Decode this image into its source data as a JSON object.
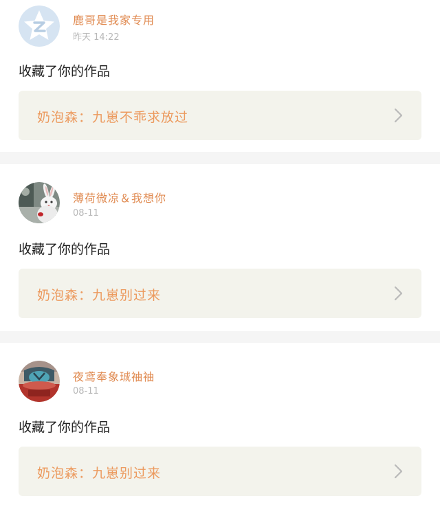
{
  "notifications": [
    {
      "username": "鹿哥是我家专用",
      "time": "昨天 14:22",
      "action": "收藏了你的作品",
      "work_text": "奶泡森：九崽不乖求放过",
      "avatar_icon": "qzone-default-avatar-icon"
    },
    {
      "username": "薄荷微凉＆我想你",
      "time": "08-11",
      "action": "收藏了你的作品",
      "work_text": "奶泡森：九崽别过来",
      "avatar_icon": "rabbit-avatar-photo"
    },
    {
      "username": "夜鸢奉象珹䄂䄂",
      "time": "08-11",
      "action": "收藏了你的作品",
      "work_text": "奶泡森：九崽别过来",
      "avatar_icon": "portrait-avatar-photo"
    }
  ],
  "colors": {
    "username": "#e08a50",
    "work_text": "#ec9a5e",
    "work_bg": "#f3f3ec",
    "divider_bg": "#f5f5f5",
    "timestamp": "#b8b8b8"
  }
}
